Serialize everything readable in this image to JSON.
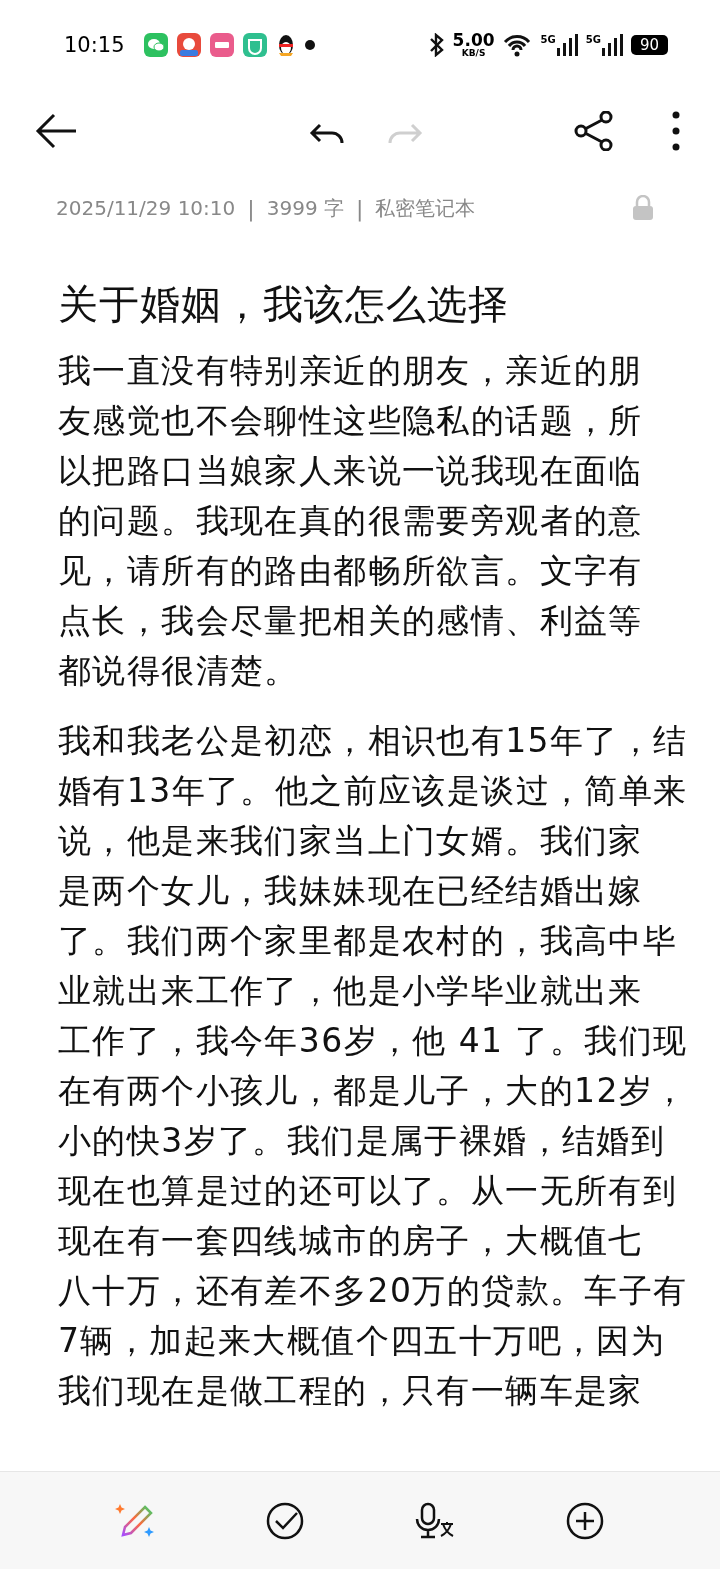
{
  "status_bar": {
    "time": "10:15",
    "speed": "5.00",
    "speed_unit": "KB/S",
    "signal_1": "5G",
    "signal_2": "5G",
    "battery": "90"
  },
  "toolbar": {
    "undo_disabled": false,
    "redo_disabled": true
  },
  "meta": {
    "date": "2025/11/29 10:10",
    "separator_1": "|",
    "word_count": "3999 字",
    "separator_2": "|",
    "notebook": "私密笔记本",
    "locked": true
  },
  "note": {
    "title": "关于婚姻，我该怎么选择",
    "paragraphs": [
      {
        "lines": [
          "我一直没有特别亲近的朋友，亲近的朋",
          "友感觉也不会聊性这些隐私的话题，所",
          "以把路口当娘家人来说一说我现在面临",
          "的问题。我现在真的很需要旁观者的意",
          "见，请所有的路由都畅所欲言。文字有",
          "点长，我会尽量把相关的感情、利益等",
          "都说得很清楚。"
        ]
      },
      {
        "lines": [
          "我和我老公是初恋，相识也有15年了，结",
          "婚有13年了。他之前应该是谈过，简单来",
          "说，他是来我们家当上门女婿。我们家",
          "是两个女儿，我妹妹现在已经结婚出嫁",
          "了。我们两个家里都是农村的，我高中毕",
          "业就出来工作了，他是小学毕业就出来",
          "工作了，我今年36岁，他 41 了。我们现",
          "在有两个小孩儿，都是儿子，大的12岁，",
          "小的快3岁了。我们是属于裸婚，结婚到",
          "现在也算是过的还可以了。从一无所有到",
          "现在有一套四线城市的房子，大概值七",
          "八十万，还有差不多20万的贷款。车子有",
          "7辆，加起来大概值个四五十万吧，因为",
          "我们现在是做工程的，只有一辆车是家"
        ]
      }
    ]
  }
}
